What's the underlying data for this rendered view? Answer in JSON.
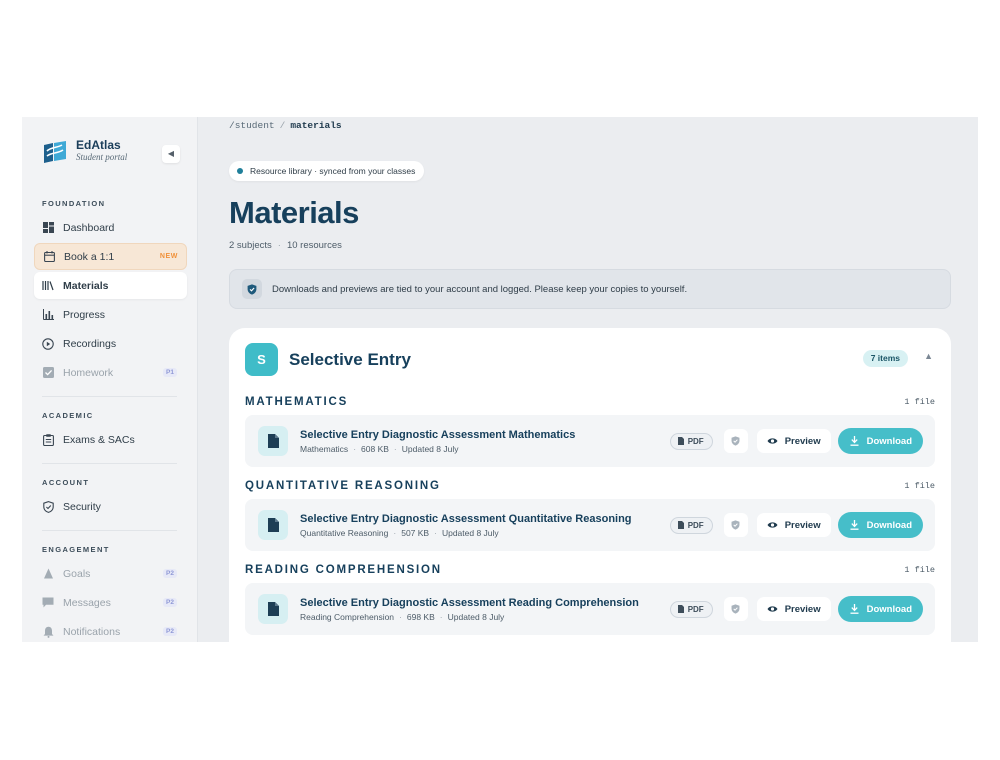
{
  "brand": {
    "name": "EdAtlas",
    "subtitle": "Student portal",
    "collapse_icon": "chevron-left-icon"
  },
  "sidebar": {
    "sections": [
      {
        "label": "FOUNDATION",
        "items": [
          {
            "label": "Dashboard",
            "icon": "grid-icon"
          },
          {
            "label": "Book a 1:1",
            "icon": "calendar-icon",
            "badge": "NEW"
          },
          {
            "label": "Materials",
            "icon": "library-icon",
            "active": true
          },
          {
            "label": "Progress",
            "icon": "bar-chart-icon"
          },
          {
            "label": "Recordings",
            "icon": "play-circle-icon"
          },
          {
            "label": "Homework",
            "icon": "checkbox-icon",
            "badge": "P1",
            "disabled": true
          }
        ]
      },
      {
        "label": "ACADEMIC",
        "items": [
          {
            "label": "Exams & SACs",
            "icon": "clipboard-icon"
          }
        ]
      },
      {
        "label": "ACCOUNT",
        "items": [
          {
            "label": "Security",
            "icon": "shield-icon"
          }
        ]
      },
      {
        "label": "ENGAGEMENT",
        "items": [
          {
            "label": "Goals",
            "icon": "flag-icon",
            "badge": "P2",
            "disabled": true
          },
          {
            "label": "Messages",
            "icon": "chat-icon",
            "badge": "P2",
            "disabled": true
          },
          {
            "label": "Notifications",
            "icon": "bell-icon",
            "badge": "P2",
            "disabled": true
          }
        ]
      }
    ]
  },
  "breadcrumb": {
    "root": "/student",
    "separator": "/",
    "current": "materials"
  },
  "header": {
    "pill": "Resource library · synced from your classes",
    "title": "Materials",
    "meta_subjects": "2 subjects",
    "meta_resources": "10 resources"
  },
  "notice": {
    "text": "Downloads and previews are tied to your account and logged. Please keep your copies to yourself."
  },
  "card": {
    "avatar": "S",
    "title": "Selective Entry",
    "count": "7 items",
    "subjects": [
      {
        "name": "MATHEMATICS",
        "count": "1 file",
        "file": {
          "name": "Selective Entry Diagnostic Assessment Mathematics",
          "subject": "Mathematics",
          "size": "608 KB",
          "updated": "Updated 8 July"
        }
      },
      {
        "name": "QUANTITATIVE REASONING",
        "count": "1 file",
        "file": {
          "name": "Selective Entry Diagnostic Assessment Quantitative Reasoning",
          "subject": "Quantitative Reasoning",
          "size": "507 KB",
          "updated": "Updated 8 July"
        }
      },
      {
        "name": "READING COMPREHENSION",
        "count": "1 file",
        "file": {
          "name": "Selective Entry Diagnostic Assessment Reading Comprehension",
          "subject": "Reading Comprehension",
          "size": "698 KB",
          "updated": "Updated 8 July"
        }
      }
    ]
  },
  "actions": {
    "pdf_label": "PDF",
    "preview_label": "Preview",
    "download_label": "Download"
  },
  "colors": {
    "accent": "#46bec9",
    "navy": "#17405c",
    "new_badge": "#f0913a",
    "book_bg": "#f7e7d6"
  }
}
